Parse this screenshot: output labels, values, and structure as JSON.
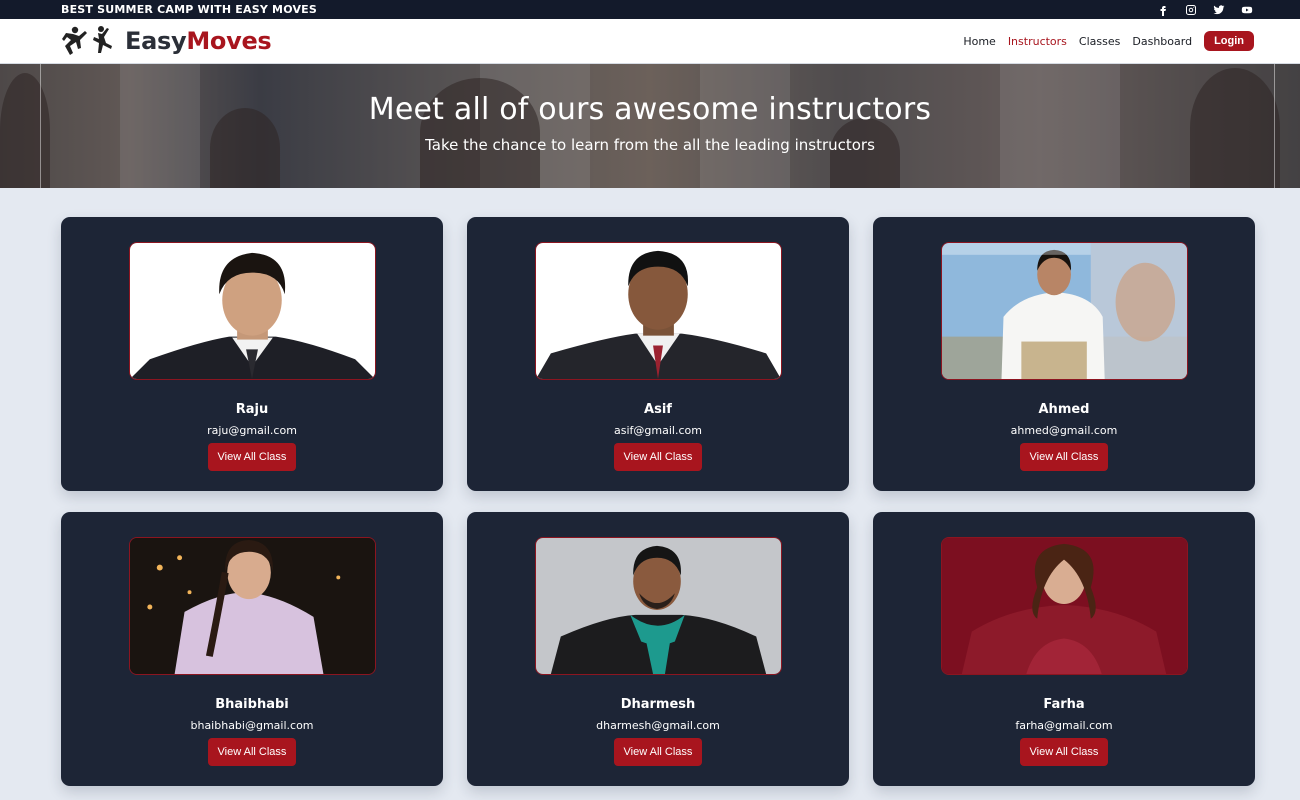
{
  "topbar": {
    "text": "BEST SUMMER CAMP WITH EASY MOVES",
    "social": [
      "facebook-icon",
      "instagram-icon",
      "twitter-icon",
      "youtube-icon"
    ]
  },
  "brand": {
    "part1": "Easy",
    "part2": "Moves"
  },
  "nav": {
    "home": "Home",
    "instructors": "Instructors",
    "classes": "Classes",
    "dashboard": "Dashboard",
    "login": "Login"
  },
  "hero": {
    "title": "Meet all of ours awesome instructors",
    "subtitle": "Take the chance to learn from the all the leading instructors"
  },
  "instructors": [
    {
      "name": "Raju",
      "email": "raju@gmail.com",
      "button": "View All Class"
    },
    {
      "name": "Asif",
      "email": "asif@gmail.com",
      "button": "View All Class"
    },
    {
      "name": "Ahmed",
      "email": "ahmed@gmail.com",
      "button": "View All Class"
    },
    {
      "name": "Bhaibhabi",
      "email": "bhaibhabi@gmail.com",
      "button": "View All Class"
    },
    {
      "name": "Dharmesh",
      "email": "dharmesh@gmail.com",
      "button": "View All Class"
    },
    {
      "name": "Farha",
      "email": "farha@gmail.com",
      "button": "View All Class"
    }
  ],
  "colors": {
    "accent": "#a8151e",
    "card": "#1d2536",
    "page": "#e4e9f1",
    "topbar": "#131a2b"
  }
}
